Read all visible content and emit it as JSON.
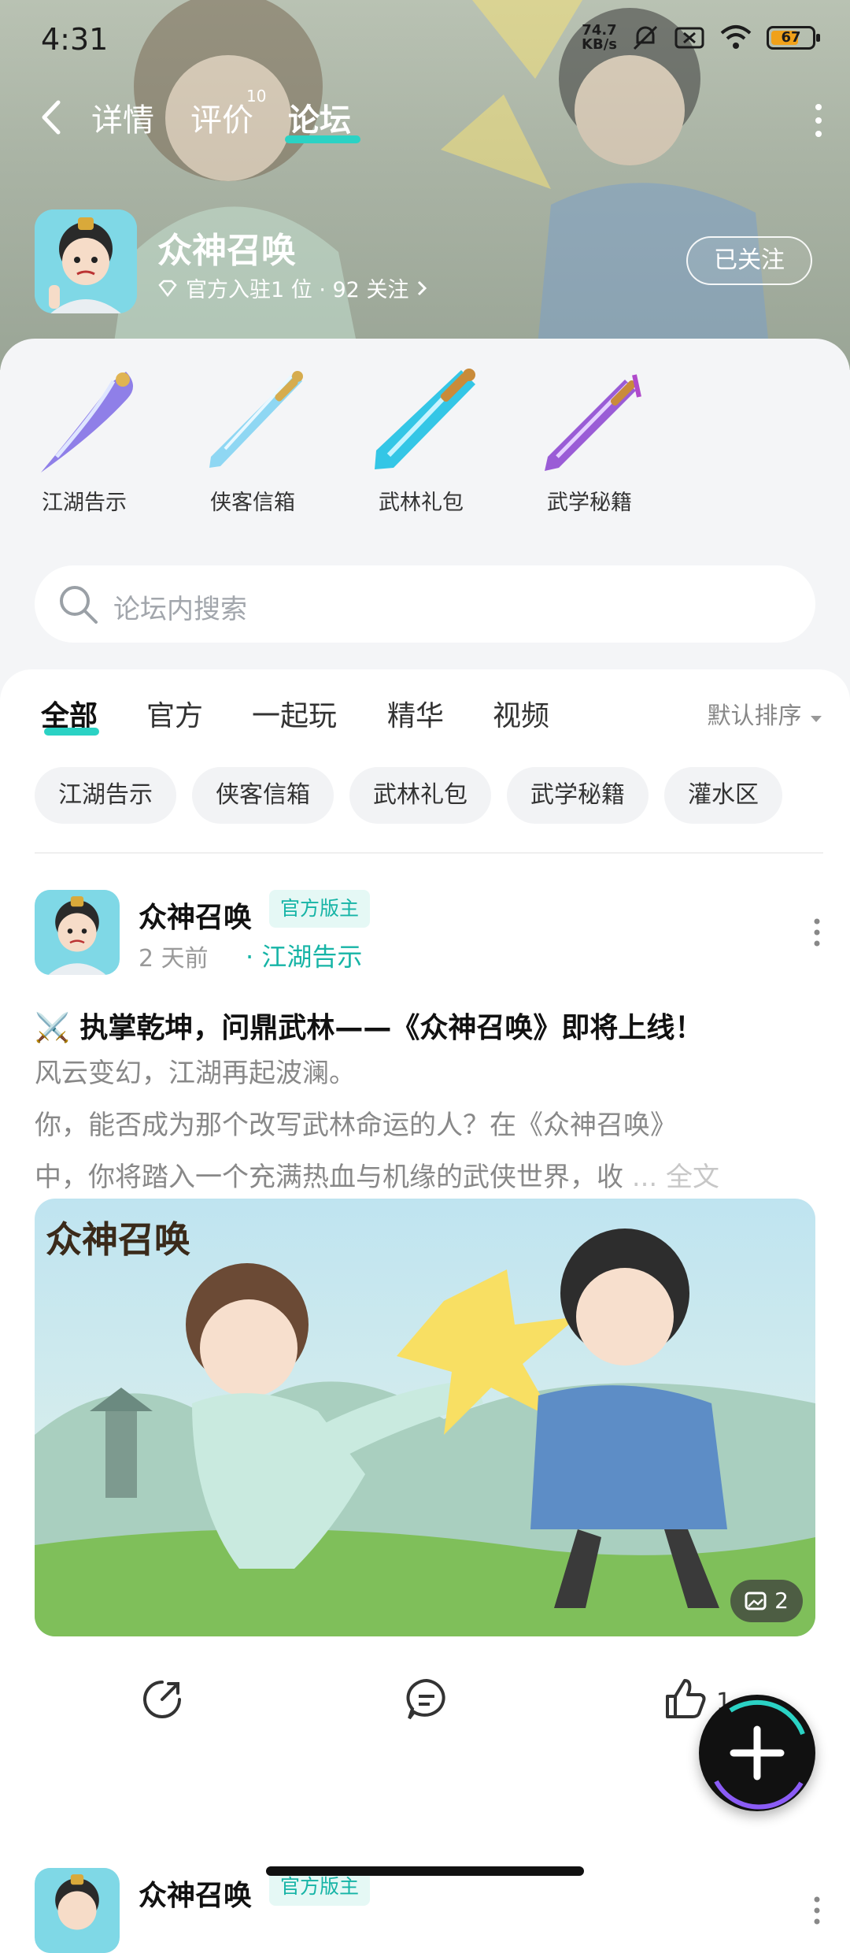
{
  "status": {
    "time": "4:31",
    "net_speed_top": "74.7",
    "net_speed_unit": "KB/s",
    "battery": "67",
    "battery_level": 0.67
  },
  "nav": {
    "tabs": [
      "详情",
      "评价",
      "论坛"
    ],
    "review_badge": "10"
  },
  "game": {
    "name": "众神召唤",
    "meta": "官方入驻1 位 · 92 关注",
    "follow_label": "已关注"
  },
  "shortcuts": [
    "江湖告示",
    "侠客信箱",
    "武林礼包",
    "武学秘籍"
  ],
  "search": {
    "placeholder": "论坛内搜索"
  },
  "feed_tabs": [
    "全部",
    "官方",
    "一起玩",
    "精华",
    "视频"
  ],
  "sort_label": "默认排序",
  "chips": [
    "江湖告示",
    "侠客信箱",
    "武林礼包",
    "武学秘籍",
    "灌水区"
  ],
  "post": {
    "author": "众神召唤",
    "role": "官方版主",
    "time": "2 天前",
    "category": "江湖告示",
    "title": "⚔️ 执掌乾坤，问鼎武林——《众神召唤》即将上线！",
    "body_lines": [
      "风云变幻，江湖再起波澜。",
      "你，能否成为那个改写武林命运的人？在《众神召唤》",
      "中，你将踏入一个充满热血与机缘的武侠世界，收"
    ],
    "read_more": "... 全文",
    "image_title": "众神召唤",
    "image_count": "2",
    "like_count": "1"
  },
  "post2": {
    "author": "众神召唤",
    "role": "官方版主"
  }
}
